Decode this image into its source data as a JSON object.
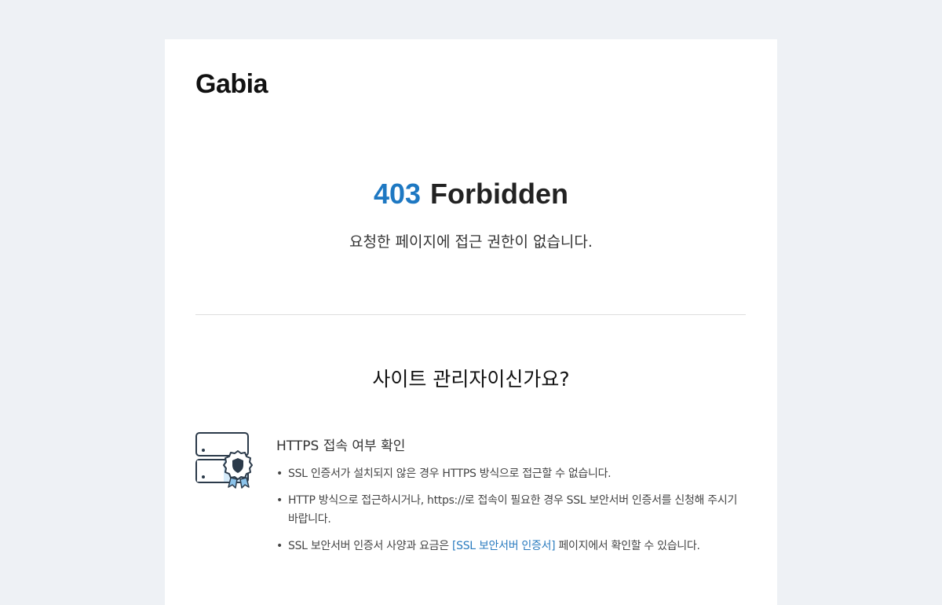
{
  "logo": "Gabia",
  "error": {
    "code": "403",
    "title": "Forbidden",
    "message": "요청한 페이지에 접근 권한이 없습니다."
  },
  "admin_heading": "사이트 관리자이신가요?",
  "https_section": {
    "icon": "ssl-server-certificate-icon",
    "title": "HTTPS 접속 여부 확인",
    "bullets": {
      "b1": "SSL 인증서가 설치되지 않은 경우 HTTPS 방식으로 접근할 수 없습니다.",
      "b2": "HTTP 방식으로 접근하시거나, https://로 접속이 필요한 경우 SSL 보안서버 인증서를 신청해 주시기 바랍니다.",
      "b3_before": "SSL 보안서버 인증서 사양과 요금은 ",
      "b3_link": "[SSL 보안서버 인증서]",
      "b3_after": " 페이지에서 확인할 수 있습니다."
    }
  },
  "colors": {
    "accent": "#1e78c2",
    "link": "#2a7bbf",
    "background": "#eef1f5"
  }
}
